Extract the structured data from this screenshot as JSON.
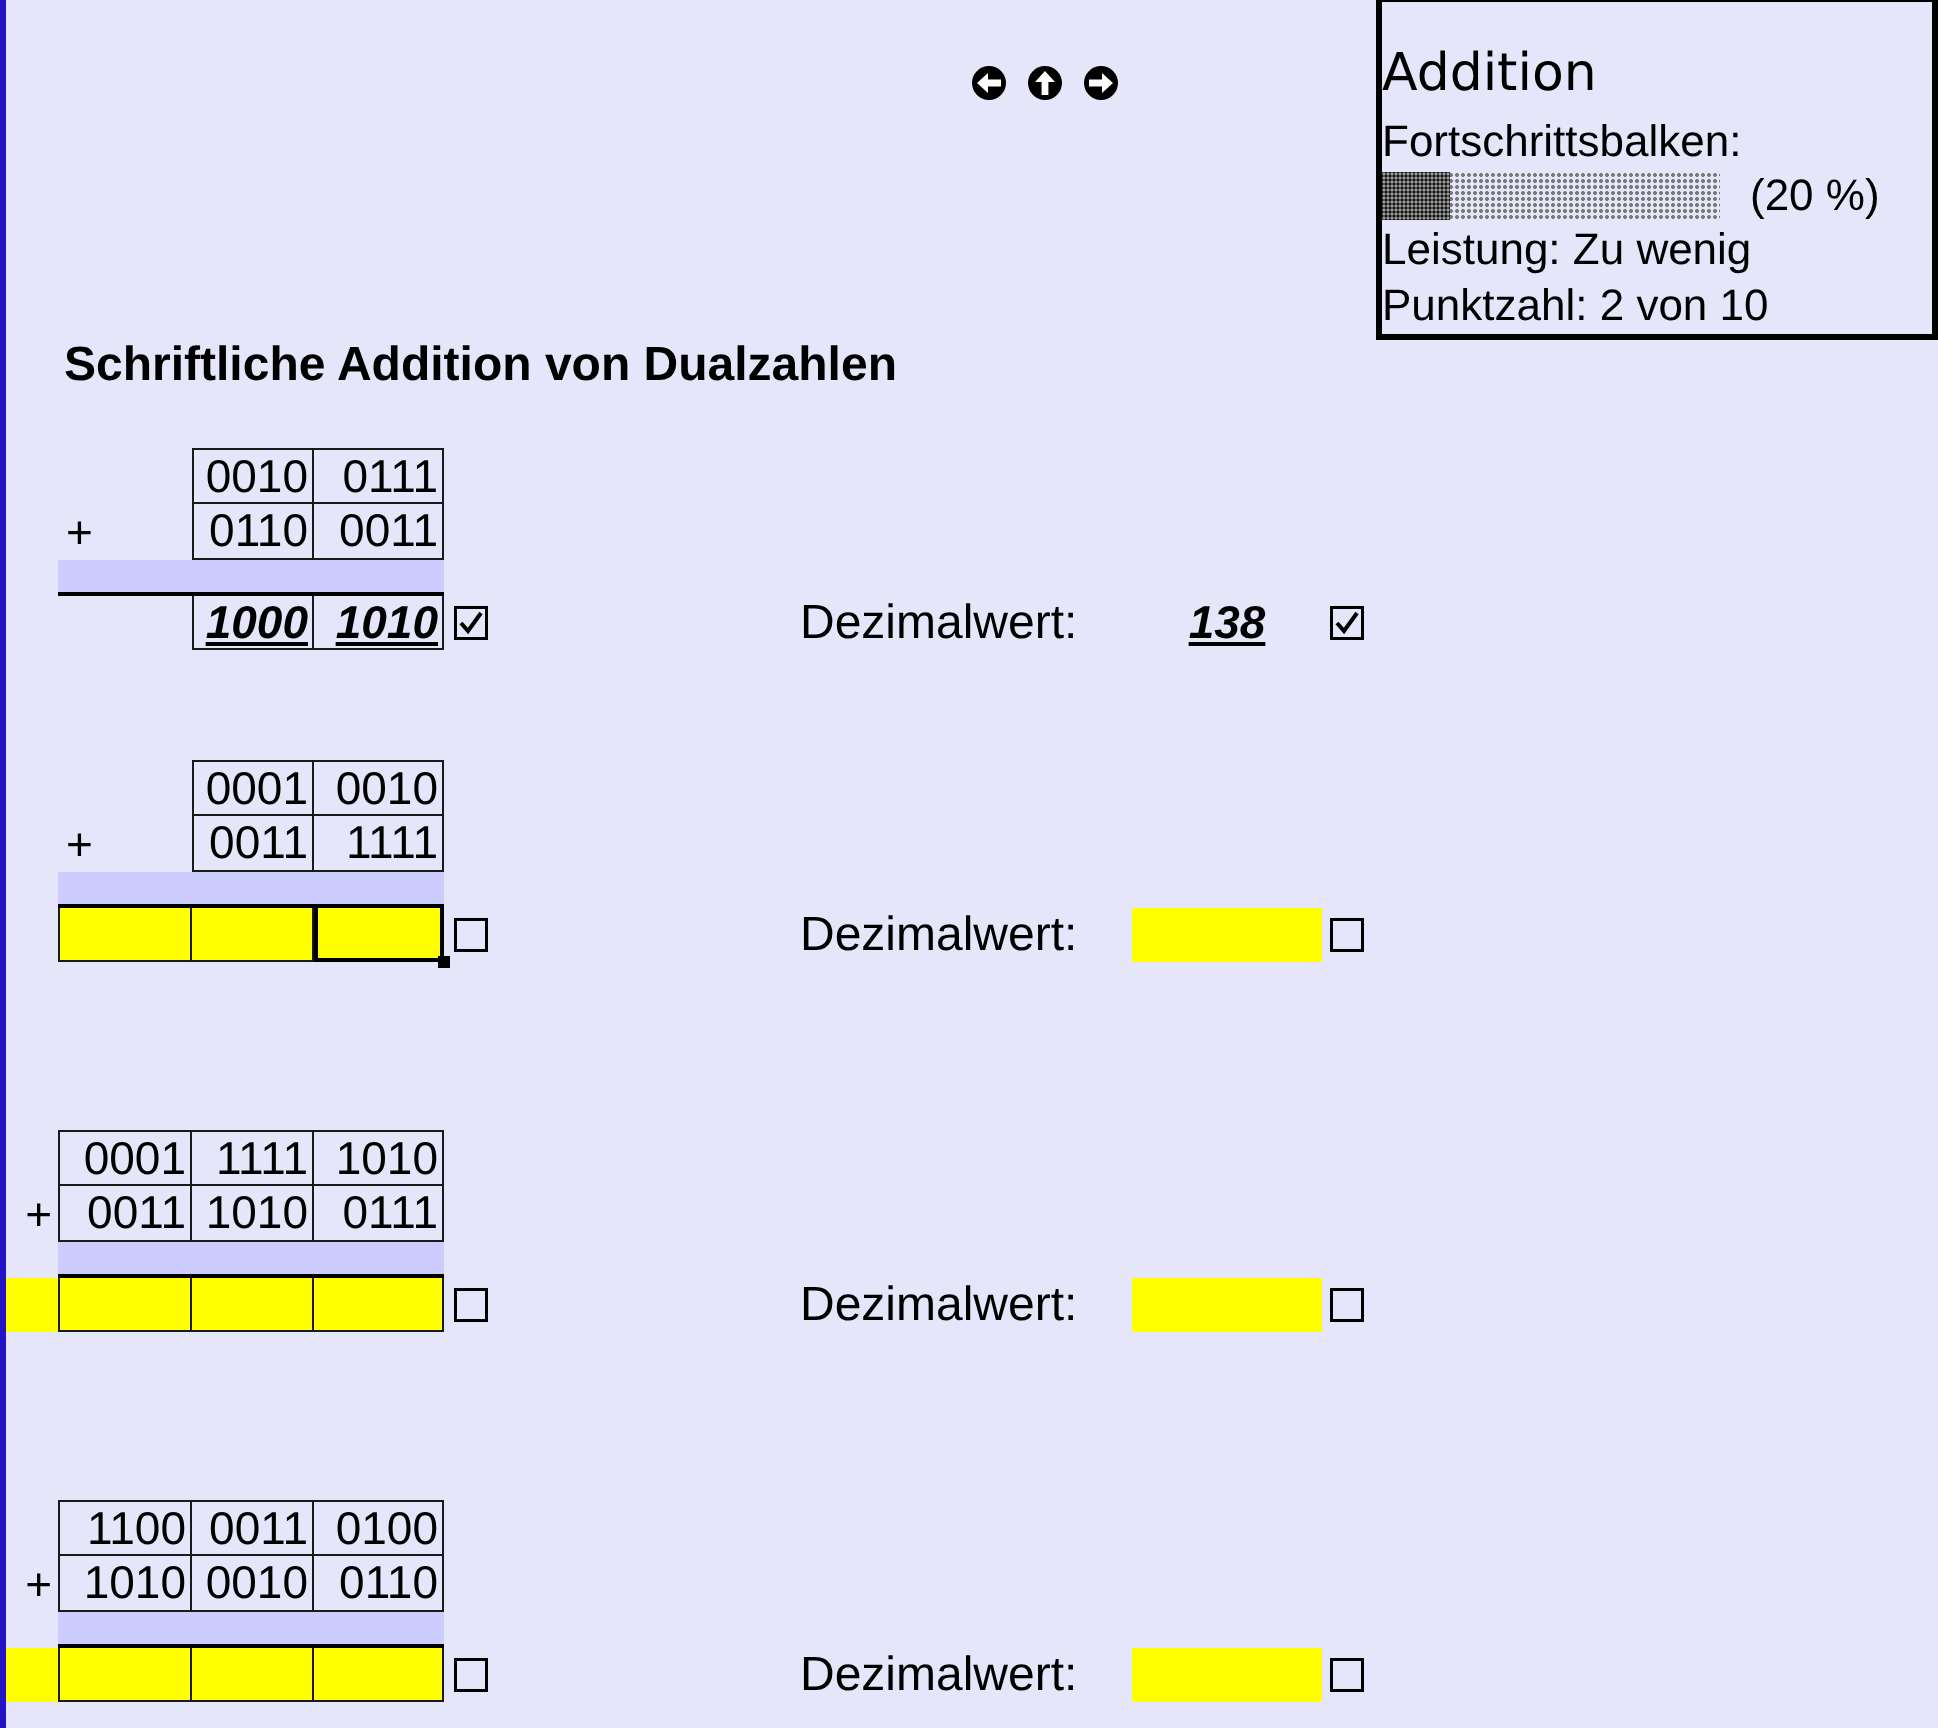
{
  "score_panel": {
    "title": "Addition",
    "progress_label": "Fortschrittsbalken:",
    "progress": {
      "level": 0.2,
      "reading": "(20 %)"
    },
    "performance": "Leistung: Zu wenig",
    "score": "Punktzahl: 2 von 10"
  },
  "heading": "Schriftliche Addition von Dualzahlen",
  "problems": [
    {
      "rows": [
        {
          "cells": [
            "0010",
            "0111"
          ]
        },
        {
          "operator": "+",
          "cells": [
            "0110",
            "0011"
          ]
        }
      ],
      "result": {
        "cells": [
          {
            "kind": "group",
            "value": "1000",
            "selected": false
          },
          {
            "kind": "group",
            "value": "1010",
            "selected": false
          }
        ],
        "checked": true
      },
      "decimal": {
        "label": "Dezimalwert:",
        "value": "138",
        "checked": true
      }
    },
    {
      "rows": [
        {
          "cells": [
            "0001",
            "0010"
          ]
        },
        {
          "operator": "+",
          "cells": [
            "0011",
            "1111"
          ]
        }
      ],
      "result": {
        "cells": [
          {
            "kind": "group",
            "selected": false
          },
          {
            "kind": "group",
            "selected": false
          },
          {
            "kind": "group",
            "selected": true
          }
        ],
        "checked": false
      },
      "decimal": {
        "label": "Dezimalwert:",
        "checked": false
      }
    },
    {
      "rows": [
        {
          "cells": [
            "0001",
            "1111",
            "1010"
          ]
        },
        {
          "operator": "+",
          "cells": [
            "0011",
            "1010",
            "0111"
          ]
        }
      ],
      "result": {
        "cells": [
          {
            "kind": "spare",
            "selected": false
          },
          {
            "kind": "group",
            "selected": false
          },
          {
            "kind": "group",
            "selected": false
          },
          {
            "kind": "group",
            "selected": false
          }
        ],
        "checked": false
      },
      "decimal": {
        "label": "Dezimalwert:",
        "checked": false
      }
    },
    {
      "rows": [
        {
          "cells": [
            "1100",
            "0011",
            "0100"
          ]
        },
        {
          "operator": "+",
          "cells": [
            "1010",
            "0010",
            "0110"
          ]
        }
      ],
      "result": {
        "cells": [
          {
            "kind": "spare",
            "selected": false
          },
          {
            "kind": "group",
            "selected": false
          },
          {
            "kind": "group",
            "selected": false
          },
          {
            "kind": "group",
            "selected": false
          }
        ],
        "checked": false
      },
      "decimal": {
        "label": "Dezimalwert:",
        "checked": false
      }
    }
  ]
}
